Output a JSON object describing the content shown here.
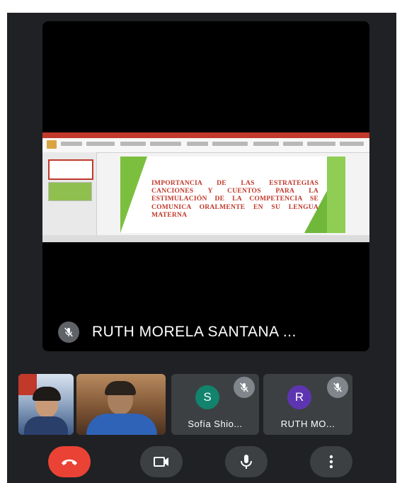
{
  "main_video": {
    "presenter_name": "RUTH MORELA SANTANA ...",
    "presenter_muted": true,
    "slide_text": "IMPORTANCIA DE LAS ESTRATEGIAS CANCIONES Y CUENTOS PARA LA ESTIMULACIÓN DE LA COMPETENCIA SE COMUNICA ORALMENTE EN SU LENGUA MATERNA"
  },
  "participants": [
    {
      "type": "video",
      "name": ""
    },
    {
      "type": "video",
      "name": ""
    },
    {
      "type": "avatar",
      "initial": "S",
      "name": "Sofía Shio...",
      "muted": true,
      "color": "#12836d"
    },
    {
      "type": "avatar",
      "initial": "R",
      "name": "RUTH MO...",
      "muted": true,
      "color": "#5e35b1"
    }
  ],
  "controls": {
    "end_call_icon": "phone-hangup-icon",
    "camera_icon": "video-camera-icon",
    "mic_icon": "microphone-icon",
    "more_icon": "more-vertical-icon",
    "end_call_color": "#ea4335"
  }
}
